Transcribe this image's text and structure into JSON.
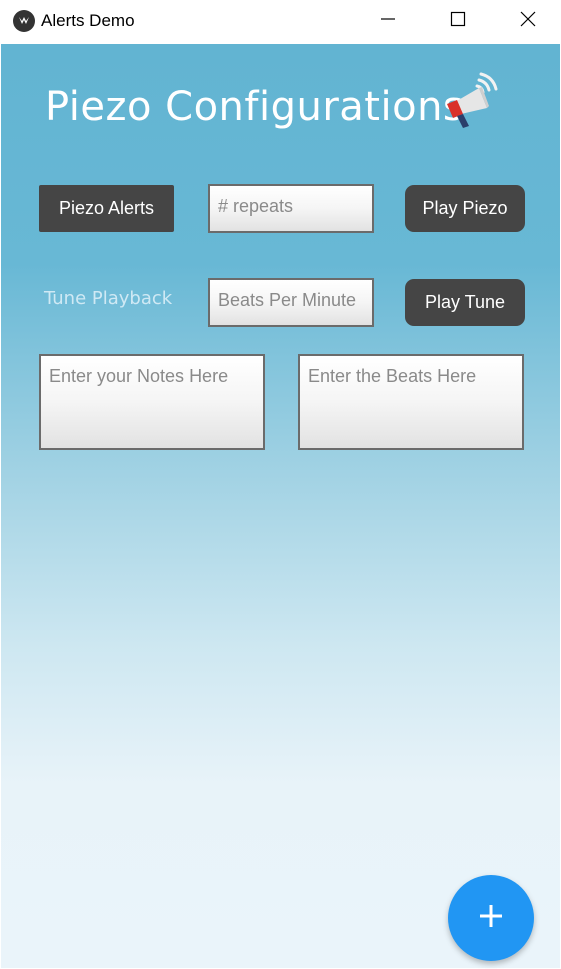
{
  "window": {
    "title": "Alerts Demo",
    "icons": {
      "app": "kivy-app-icon",
      "minimize": "minimize-icon",
      "maximize": "maximize-icon",
      "close": "close-icon"
    }
  },
  "page": {
    "title": "Piezo Configurations",
    "title_icon": "megaphone-icon"
  },
  "piezo": {
    "alerts_button": "Piezo Alerts",
    "repeats_placeholder": "# repeats",
    "play_button": "Play Piezo"
  },
  "tune": {
    "label": "Tune Playback",
    "bpm_placeholder": "Beats Per Minute",
    "play_button": "Play Tune",
    "notes_placeholder": "Enter your Notes Here",
    "beats_placeholder": "Enter the Beats Here"
  },
  "fab": {
    "icon": "plus-icon",
    "glyph": "+"
  },
  "colors": {
    "background_top": "#62b4d2",
    "background_bottom": "#eaf4fa",
    "button": "#454545",
    "fab": "#2196f3"
  }
}
